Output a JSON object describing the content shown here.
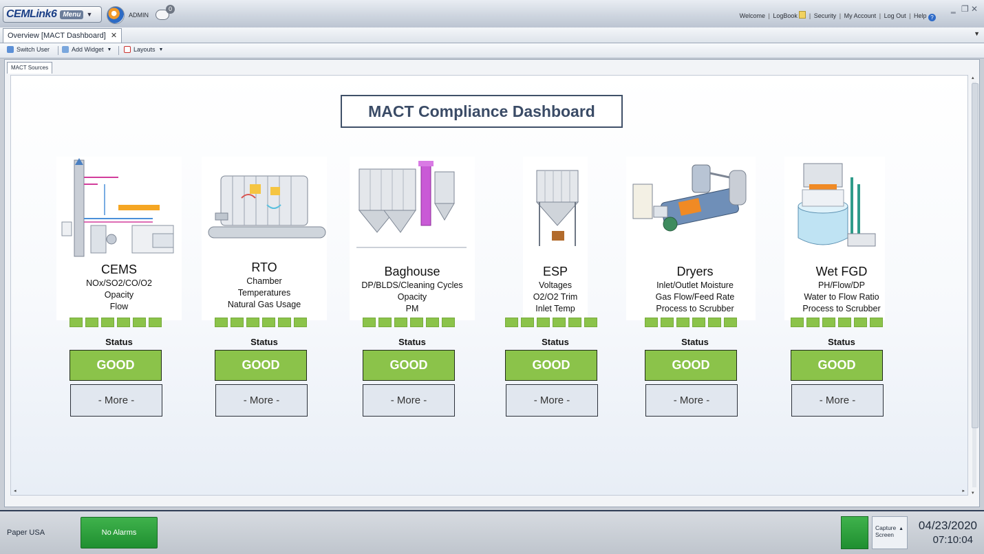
{
  "app": {
    "logo_text": "CEMLink6",
    "logo_menu": "Menu",
    "user": "ADMIN",
    "message_count": "0",
    "top_nav": [
      "Welcome",
      "LogBook",
      "Security",
      "My Account",
      "Log Out",
      "Help"
    ]
  },
  "tabs": {
    "document_tab": "Overview [MACT Dashboard]"
  },
  "toolbar": {
    "switch_user": "Switch User",
    "add_widget": "Add Widget",
    "layouts": "Layouts"
  },
  "workspace": {
    "inner_tab": "MACT Sources"
  },
  "dashboard": {
    "title": "MACT Compliance Dashboard",
    "status_label": "Status",
    "good_label": "GOOD",
    "more_label": "- More -",
    "accent_green": "#8bc34a",
    "sources": [
      {
        "name": "CEMS",
        "lines": [
          "NOx/SO2/CO/O2",
          "Opacity",
          "Flow"
        ],
        "status": "GOOD"
      },
      {
        "name": "RTO",
        "lines": [
          "Chamber",
          "Temperatures",
          "Natural Gas Usage"
        ],
        "status": "GOOD"
      },
      {
        "name": "Baghouse",
        "lines": [
          "DP/BLDS/Cleaning Cycles",
          "Opacity",
          "PM"
        ],
        "status": "GOOD"
      },
      {
        "name": "ESP",
        "lines": [
          "Voltages",
          "O2/O2 Trim",
          "Inlet Temp"
        ],
        "status": "GOOD"
      },
      {
        "name": "Dryers",
        "lines": [
          "Inlet/Outlet Moisture",
          "Gas Flow/Feed Rate",
          "Process to Scrubber"
        ],
        "status": "GOOD"
      },
      {
        "name": "Wet FGD",
        "lines": [
          "PH/Flow/DP",
          "Water to Flow Ratio",
          "Process to Scrubber"
        ],
        "status": "GOOD"
      }
    ]
  },
  "statusbar": {
    "site": "Paper USA",
    "alarms": "No Alarms",
    "capture_line1": "Capture",
    "capture_line2": "Screen",
    "date": "04/23/2020",
    "time": "07:10:04"
  }
}
